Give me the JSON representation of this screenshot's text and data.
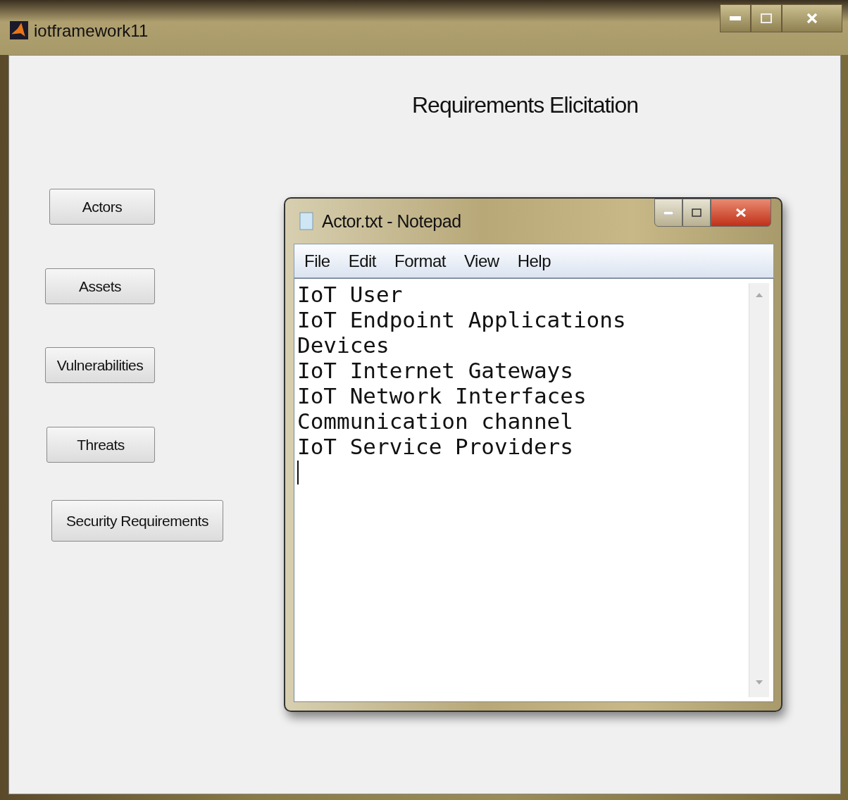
{
  "window": {
    "title": "iotframework11"
  },
  "heading": "Requirements Elicitation",
  "buttons": [
    "Actors",
    "Assets",
    "Vulnerabilities",
    "Threats",
    "Security Requirements"
  ],
  "notepad": {
    "title": "Actor.txt - Notepad",
    "menu": [
      "File",
      "Edit",
      "Format",
      "View",
      "Help"
    ],
    "lines": [
      "IoT User",
      "IoT Endpoint Applications",
      "Devices",
      "IoT Internet Gateways",
      "IoT Network Interfaces",
      "Communication channel",
      "IoT Service Providers"
    ]
  }
}
